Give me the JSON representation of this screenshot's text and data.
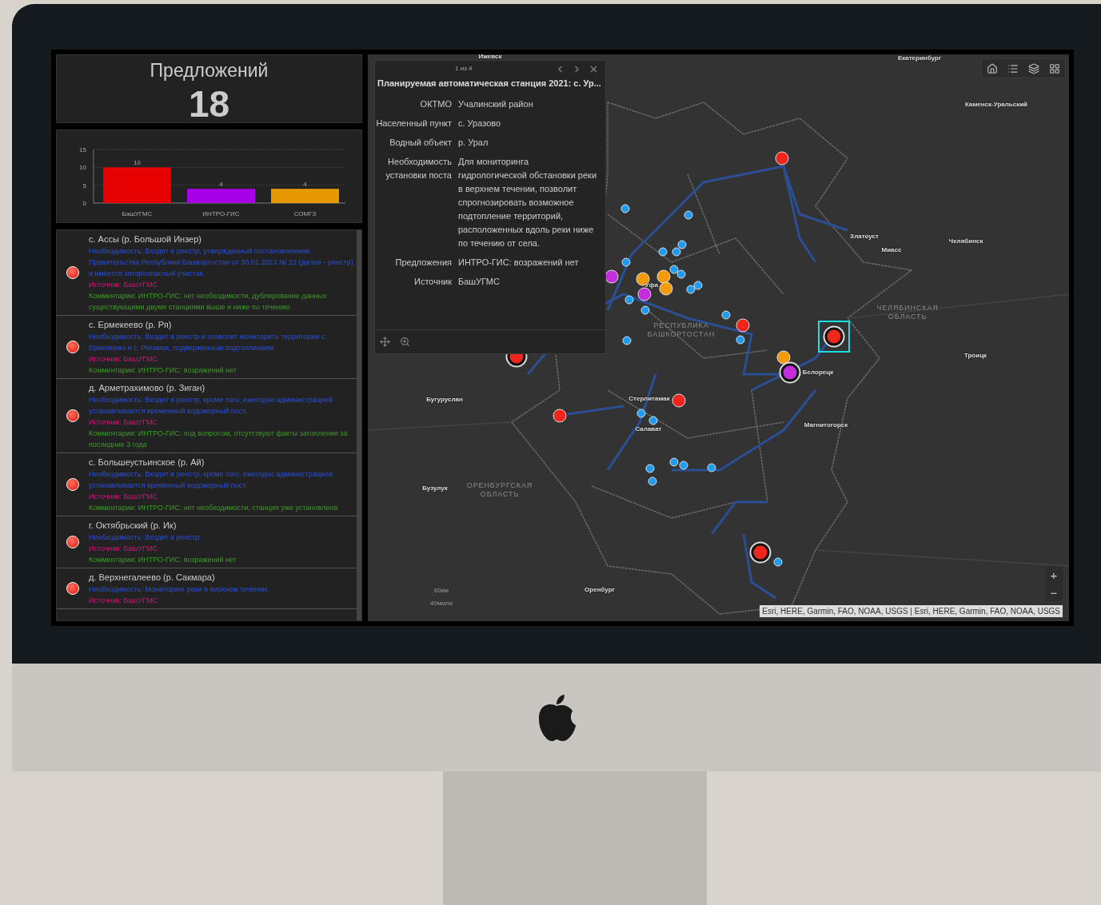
{
  "kpi": {
    "title": "Предложений",
    "value": "18"
  },
  "chart": {
    "chart_data": {
      "type": "bar",
      "categories": [
        "БашУГМС",
        "ИНТРО-ГИС",
        "СОМГЗ"
      ],
      "values": [
        10,
        4,
        4
      ],
      "colors": [
        "#e60000",
        "#a800e6",
        "#e69800"
      ],
      "yticks": [
        0,
        5,
        10,
        15
      ],
      "ylim": [
        0,
        15
      ],
      "data_labels": true
    }
  },
  "list": [
    {
      "title": "с. Ассы (р. Большой Инзер)",
      "necessity": "Необходимость: Входит в реестр, утвержденный постановлением Правительства Республики Башкортостан от 30.01.2013 № 22 (далее - реестр) и имеется заторoопасный участок.",
      "source": "Источник: БашУГМС",
      "comment": "Комментарии: ИНТРО-ГИС: нет необходимости, дублирование данных существующими двумя станциями выше и ниже по течению"
    },
    {
      "title": "с. Ермекеево (р. Ря)",
      "necessity": "Необходимость: Входит в реестр и позволит мониторить территории с. Ермекеево и с. Рятамак, подверженным подтоплениям.",
      "source": "Источник: БашУГМС",
      "comment": "Комментарии: ИНТРО-ГИС: возражений нет"
    },
    {
      "title": "д. Арметрахимово (р. Зиган)",
      "necessity": "Необходимость: Входит в реестр, кроме того, ежегодно администрацией устанавливается временный водомерный пост.",
      "source": "Источник: БашУГМС",
      "comment": "Комментарии: ИНТРО-ГИС: под вопросом, отсутствуют факты затопления за последние 3 года"
    },
    {
      "title": "с. Большеустьинское (р. Ай)",
      "necessity": "Необходимость: Входит в реестр, кроме того, ежегодно администрацией устанавливается временный водомерный пост.",
      "source": "Источник: БашУГМС",
      "comment": "Комментарии: ИНТРО-ГИС: нет необходимости, станция уже установлена"
    },
    {
      "title": "г. Октябрьский (р. Ик)",
      "necessity": "Необходимость: Входит в реестр.",
      "source": "Источник: БашУГМС",
      "comment": "Комментарии: ИНТРО-ГИС: возражений нет"
    },
    {
      "title": "д. Верхнегалеево (р. Сакмара)",
      "necessity": "Необходимость: Мониторинг реки в верхнем течении.",
      "source": "Источник: БашУГМС"
    }
  ],
  "popup": {
    "counter": "1 из 4",
    "title": "Планируемая автоматическая станция 2021: с. Ур...",
    "fields": [
      {
        "label": "ОКТМО",
        "value": "Учалинский район"
      },
      {
        "label": "Населенный пункт",
        "value": "с. Уразово"
      },
      {
        "label": "Водный объект",
        "value": "р. Урал"
      },
      {
        "label": "Необходимость установки поста",
        "value": "Для мониторинга гидрологической обстановки реки в верхнем течении, позволит спрогнозировать возможное подтопление территорий, расположенных вдоль реки ниже по течению от села."
      },
      {
        "label": "Предложения",
        "value": "ИНТРО-ГИС: возражений нет"
      },
      {
        "label": "Источник",
        "value": "БашУГМС"
      }
    ]
  },
  "map": {
    "labels": [
      {
        "text": "Ижевск",
        "kind": "city"
      },
      {
        "text": "Екатеринбург",
        "kind": "city"
      },
      {
        "text": "Каменск-Уральский",
        "kind": "city"
      },
      {
        "text": "Златоуст",
        "kind": "city"
      },
      {
        "text": "Миасс",
        "kind": "city"
      },
      {
        "text": "Челябинск",
        "kind": "city"
      },
      {
        "text": "ЧЕЛЯБИНСКАЯ ОБЛАСТЬ",
        "kind": "region"
      },
      {
        "text": "Уфа",
        "kind": "city"
      },
      {
        "text": "РЕСПУБЛИКА БАШКОРТОСТАН",
        "kind": "region"
      },
      {
        "text": "Троицк",
        "kind": "city"
      },
      {
        "text": "Белорецк",
        "kind": "city"
      },
      {
        "text": "Бугуруслан",
        "kind": "city"
      },
      {
        "text": "Стерлитамак",
        "kind": "city"
      },
      {
        "text": "Салават",
        "kind": "city"
      },
      {
        "text": "Магнитогорск",
        "kind": "city"
      },
      {
        "text": "Бузулук",
        "kind": "city"
      },
      {
        "text": "ОРЕНБУРГСКАЯ ОБЛАСТЬ",
        "kind": "region"
      },
      {
        "text": "Оренбург",
        "kind": "city"
      }
    ],
    "scale": [
      "60км",
      "40мили"
    ],
    "attribution": "Esri, HERE, Garmin, FAO, NOAA, USGS | Esri, HERE, Garmin, FAO, NOAA, USGS",
    "zoom": [
      "+",
      "−"
    ]
  }
}
